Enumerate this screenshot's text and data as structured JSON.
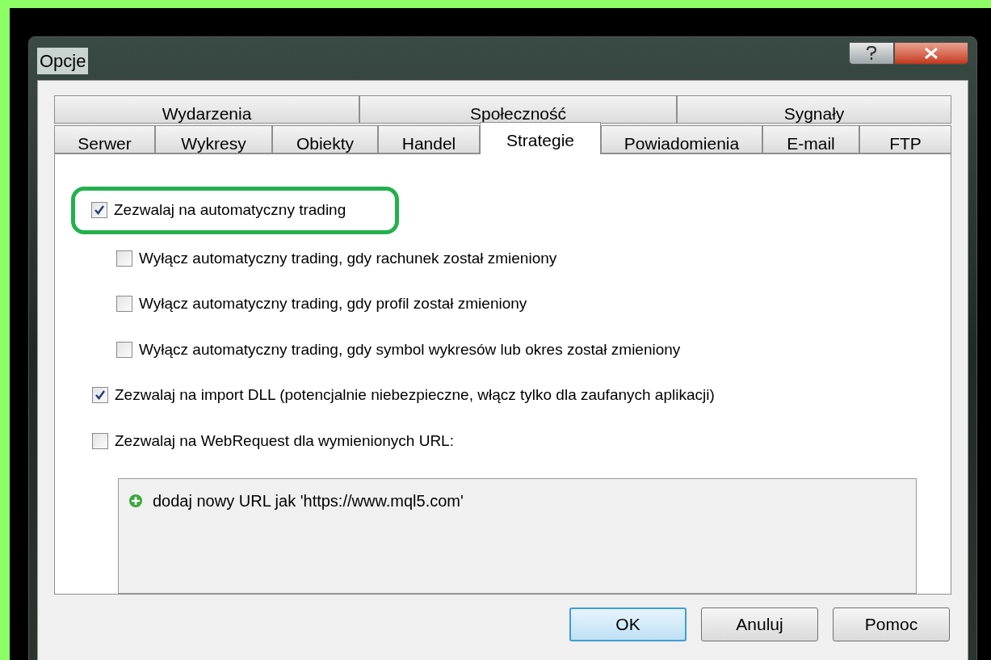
{
  "window": {
    "title": "Opcje"
  },
  "tabs_top": [
    {
      "label": "Wydarzenia",
      "selected": false
    },
    {
      "label": "Społeczność",
      "selected": false
    },
    {
      "label": "Sygnały",
      "selected": false
    }
  ],
  "tabs_bottom": [
    {
      "label": "Serwer",
      "selected": false
    },
    {
      "label": "Wykresy",
      "selected": false
    },
    {
      "label": "Obiekty",
      "selected": false
    },
    {
      "label": "Handel",
      "selected": false
    },
    {
      "label": "Strategie",
      "selected": true
    },
    {
      "label": "Powiadomienia",
      "selected": false
    },
    {
      "label": "E-mail",
      "selected": false
    },
    {
      "label": "FTP",
      "selected": false
    }
  ],
  "options": [
    {
      "label": "Zezwalaj na automatyczny trading",
      "checked": true,
      "highlighted": true,
      "children": [
        {
          "label": "Wyłącz automatyczny trading, gdy rachunek został zmieniony",
          "checked": false
        },
        {
          "label": "Wyłącz automatyczny trading, gdy profil został zmieniony",
          "checked": false
        },
        {
          "label": "Wyłącz automatyczny trading, gdy symbol wykresów lub okres został zmieniony",
          "checked": false
        }
      ]
    },
    {
      "label": "Zezwalaj na import DLL (potencjalnie niebezpieczne, włącz tylko dla zaufanych aplikacji)",
      "checked": true,
      "highlighted": false
    },
    {
      "label": "Zezwalaj na WebRequest dla wymienionych URL:",
      "checked": false,
      "highlighted": false
    }
  ],
  "url_list": {
    "items": [
      "dodaj nowy URL jak 'https://www.mql5.com'"
    ]
  },
  "buttons": [
    {
      "label": "OK",
      "default": true
    },
    {
      "label": "Anuluj",
      "default": false
    },
    {
      "label": "Pomoc",
      "default": false
    }
  ]
}
